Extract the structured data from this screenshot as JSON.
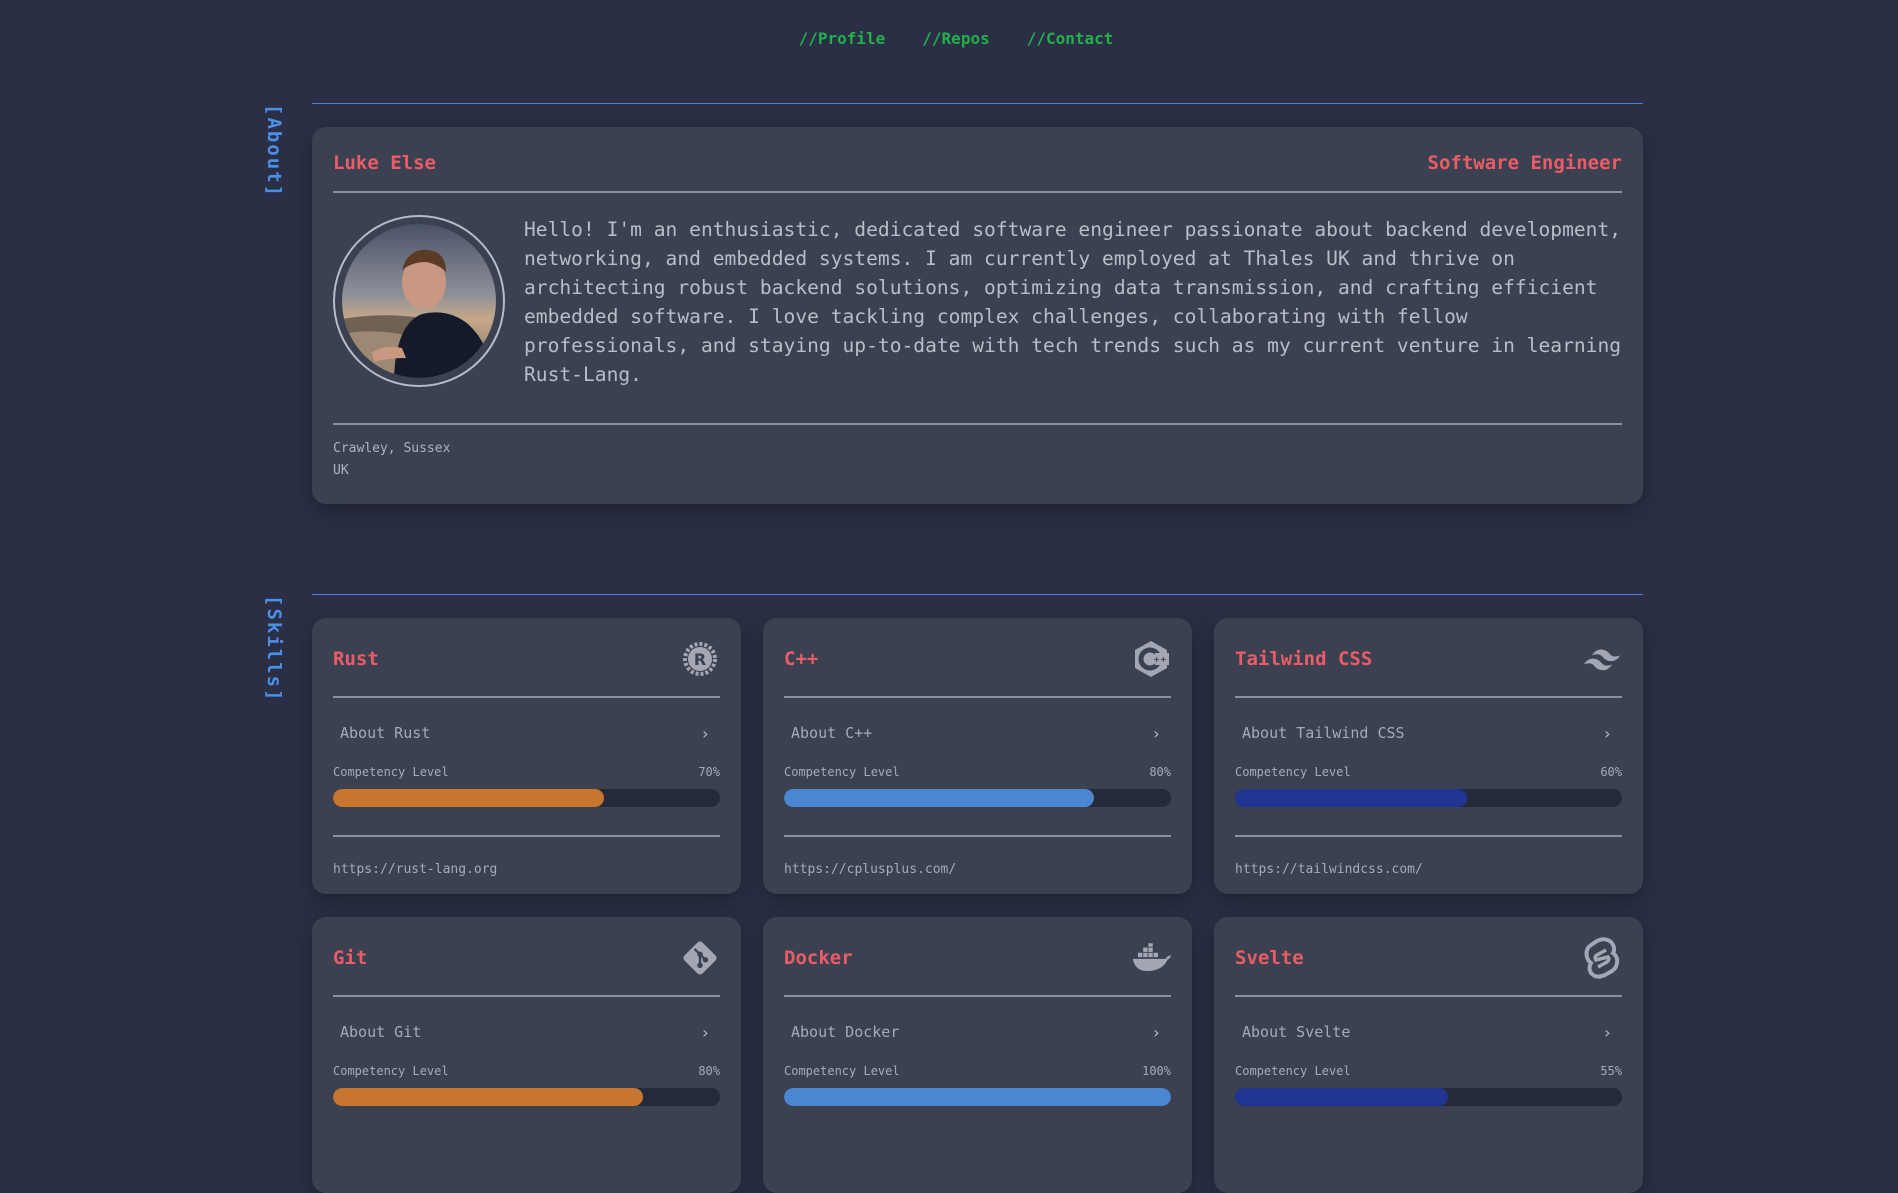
{
  "nav": {
    "items": [
      {
        "label": "//Profile"
      },
      {
        "label": "//Repos"
      },
      {
        "label": "//Contact"
      }
    ]
  },
  "sections": {
    "about": "[About]",
    "skills": "[Skills]"
  },
  "profile": {
    "name": "Luke Else",
    "role": "Software Engineer",
    "bio": "Hello! I'm an enthusiastic, dedicated software engineer passionate about backend development, networking, and embedded systems. I am currently employed at Thales UK and thrive on architecting robust backend solutions, optimizing data transmission, and crafting efficient embedded software. I love tackling complex challenges, collaborating with fellow professionals, and staying up-to-date with tech trends such as my current venture in learning Rust-Lang.",
    "location_line1": "Crawley, Sussex",
    "location_line2": "UK"
  },
  "competency_label": "Competency Level",
  "skills": [
    {
      "name": "Rust",
      "about": "About Rust",
      "level": "70%",
      "level_value": 70,
      "color": "#c8752e",
      "link": "https://rust-lang.org",
      "icon": "rust-icon"
    },
    {
      "name": "C++",
      "about": "About C++",
      "level": "80%",
      "level_value": 80,
      "color": "#4b86d1",
      "link": "https://cplusplus.com/",
      "icon": "cpp-icon"
    },
    {
      "name": "Tailwind CSS",
      "about": "About Tailwind CSS",
      "level": "60%",
      "level_value": 60,
      "color": "#1f3591",
      "link": "https://tailwindcss.com/",
      "icon": "tailwind-icon"
    },
    {
      "name": "Git",
      "about": "About Git",
      "level": "80%",
      "level_value": 80,
      "color": "#c8752e",
      "link": "",
      "icon": "git-icon"
    },
    {
      "name": "Docker",
      "about": "About Docker",
      "level": "100%",
      "level_value": 100,
      "color": "#4b86d1",
      "link": "",
      "icon": "docker-icon"
    },
    {
      "name": "Svelte",
      "about": "About Svelte",
      "level": "55%",
      "level_value": 55,
      "color": "#1f3591",
      "link": "",
      "icon": "svelte-icon"
    }
  ],
  "colors": {
    "background": "#2a2f45",
    "card": "#3c4152",
    "accent_red": "#ea5c66",
    "accent_green": "#22b04a",
    "accent_blue": "#4c8fe6"
  }
}
